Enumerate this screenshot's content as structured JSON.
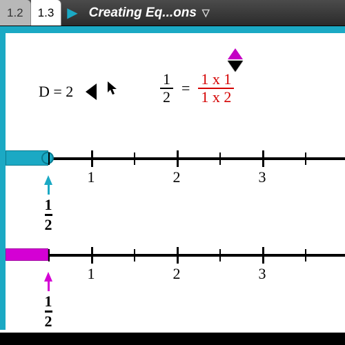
{
  "tabs": {
    "t1": "1.2",
    "t2": "1.3"
  },
  "title_text": "Creating Eq...ons",
  "d_row": {
    "label": "D = 2"
  },
  "equation": {
    "left": {
      "num": "1",
      "den": "2"
    },
    "eq": "=",
    "right": {
      "num": "1 x 1",
      "den": "1 x 2"
    }
  },
  "line1": {
    "ticks": {
      "t1": "1",
      "t2": "2",
      "t3": "3"
    },
    "pointer": {
      "num": "1",
      "den": "2"
    }
  },
  "line2": {
    "ticks": {
      "t1": "1",
      "t2": "2",
      "t3": "3"
    },
    "pointer": {
      "num": "1",
      "den": "2"
    }
  }
}
